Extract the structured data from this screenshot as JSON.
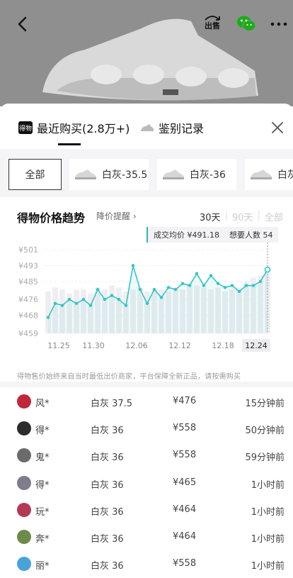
{
  "header": {
    "back_icon": "chevron-left-icon",
    "sell_label": "出售",
    "wechat_icon": "wechat-icon",
    "more_icon": "more-dots-icon"
  },
  "tabs": [
    {
      "icon_text": "得物",
      "label": "最近购买(2.8万+)",
      "active": true
    },
    {
      "icon": "shoe-icon",
      "label": "鉴别记录",
      "active": false
    }
  ],
  "sizes": [
    {
      "label": "全部",
      "selected": true
    },
    {
      "label": "白灰-35.5"
    },
    {
      "label": "白灰-36"
    },
    {
      "label": "白灰"
    }
  ],
  "trend": {
    "title": "得物价格趋势",
    "alert_label": "降价提醒",
    "alert_arrow": "›",
    "ranges": [
      "30天",
      "90天",
      "全部"
    ],
    "active_range": "30天",
    "tooltip": {
      "avg_price": "成交均价 ¥491.18",
      "want_count": "想要人数 54"
    },
    "note": "得物售价始终来自当时最低出价商家，平台保障全新正品，请按需购买"
  },
  "chart_data": {
    "type": "line",
    "ylabels": [
      "¥501",
      "¥493",
      "¥485",
      "¥476",
      "¥468",
      "¥459"
    ],
    "yticks": [
      501,
      493,
      485,
      476,
      468,
      459
    ],
    "ylim": [
      459,
      501
    ],
    "xlabels": [
      "11.25",
      "11.30",
      "12.06",
      "12.12",
      "12.18",
      "12.24"
    ],
    "highlighted_x": "12.24",
    "series": [
      {
        "values": [
          467,
          474,
          473,
          476,
          474,
          476,
          473,
          481,
          476,
          478,
          476,
          473,
          493,
          481,
          474,
          481,
          477,
          482,
          481,
          484,
          483,
          489,
          483,
          488,
          484,
          482,
          483,
          480,
          483,
          483,
          485,
          491
        ]
      }
    ],
    "bars": [
      480,
      482,
      481,
      479,
      481,
      481,
      479,
      482,
      481,
      483,
      482,
      480,
      481,
      482,
      480,
      481,
      481,
      480,
      482,
      481,
      484,
      483,
      482,
      481,
      482,
      480,
      481,
      482,
      485,
      487,
      488,
      490
    ],
    "line_color": "#33c5c5",
    "bar_color": "#eeeef2"
  },
  "purchases": [
    {
      "name": "风*",
      "spec": "白灰 37.5",
      "price": "¥476",
      "time": "15分钟前",
      "avatar_color": "#c0283a"
    },
    {
      "name": "得*",
      "spec": "白灰 36",
      "price": "¥558",
      "time": "50分钟前",
      "avatar_color": "#2c2c2c"
    },
    {
      "name": "鬼*",
      "spec": "白灰 36",
      "price": "¥558",
      "time": "59分钟前",
      "avatar_color": "#6b6b6b"
    },
    {
      "name": "得*",
      "spec": "白灰 36",
      "price": "¥465",
      "time": "1小时前",
      "avatar_color": "#7d7d8c"
    },
    {
      "name": "玩*",
      "spec": "白灰 36",
      "price": "¥464",
      "time": "1小时前",
      "avatar_color": "#b33a55"
    },
    {
      "name": "奔*",
      "spec": "白灰 36",
      "price": "¥464",
      "time": "1小时前",
      "avatar_color": "#6d8a4a"
    },
    {
      "name": "丽*",
      "spec": "白灰 36",
      "price": "¥558",
      "time": "1小时前",
      "avatar_color": "#4aa3d8"
    }
  ]
}
